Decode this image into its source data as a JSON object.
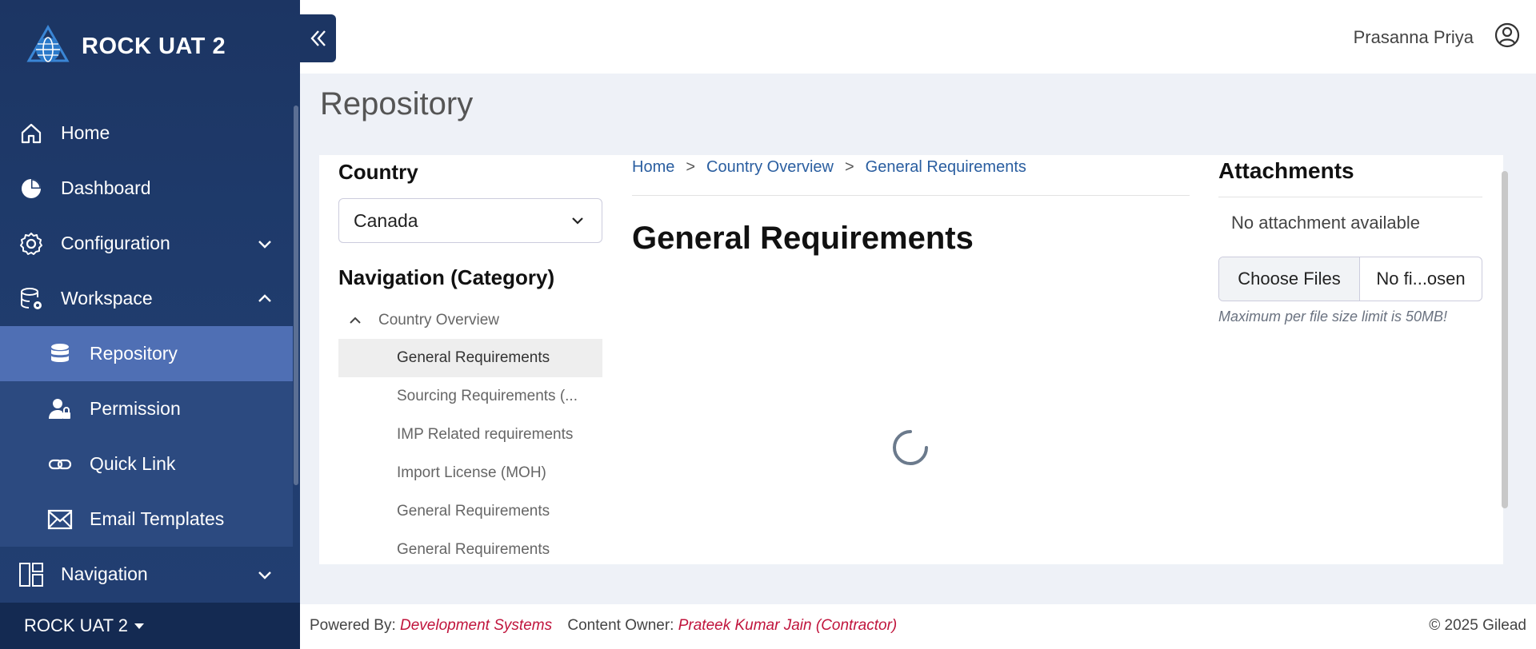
{
  "app": {
    "name": "ROCK UAT 2"
  },
  "sidebar": {
    "items": [
      {
        "label": "Home",
        "icon": "home-icon"
      },
      {
        "label": "Dashboard",
        "icon": "pie-chart-icon"
      },
      {
        "label": "Configuration",
        "icon": "gear-icon",
        "expandable": true,
        "expanded": false
      },
      {
        "label": "Workspace",
        "icon": "database-settings-icon",
        "expandable": true,
        "expanded": true
      },
      {
        "label": "Navigation",
        "icon": "layout-icon",
        "expandable": true,
        "expanded": false
      }
    ],
    "workspace_children": [
      {
        "label": "Repository",
        "icon": "database-icon",
        "active": true
      },
      {
        "label": "Permission",
        "icon": "user-lock-icon"
      },
      {
        "label": "Quick Link",
        "icon": "link-icon"
      },
      {
        "label": "Email Templates",
        "icon": "envelope-icon"
      }
    ],
    "footer": {
      "label": "ROCK UAT 2"
    }
  },
  "topbar": {
    "user_name": "Prasanna Priya"
  },
  "page": {
    "title": "Repository"
  },
  "country": {
    "label": "Country",
    "selected": "Canada"
  },
  "navigation": {
    "label": "Navigation (Category)",
    "parent": "Country Overview",
    "children": [
      {
        "label": "General Requirements",
        "active": true
      },
      {
        "label": "Sourcing Requirements (..."
      },
      {
        "label": "IMP Related requirements"
      },
      {
        "label": "Import License (MOH)"
      },
      {
        "label": "General Requirements"
      },
      {
        "label": "General Requirements"
      }
    ]
  },
  "breadcrumb": {
    "items": [
      "Home",
      "Country Overview",
      "General Requirements"
    ],
    "separator": ">"
  },
  "document": {
    "title": "General Requirements"
  },
  "attachments": {
    "label": "Attachments",
    "empty_text": "No attachment available",
    "choose_label": "Choose Files",
    "file_status": "No fi...osen",
    "note": "Maximum per file size limit is 50MB!"
  },
  "footer": {
    "powered_label": "Powered By:",
    "powered_value": "Development Systems",
    "owner_label": "Content Owner:",
    "owner_value": "Prateek Kumar Jain (Contractor)",
    "copyright": "© 2025 Gilead"
  },
  "colors": {
    "sidebar": "#1f3b6c",
    "sidebar_active": "#4f6fb4",
    "link": "#2a5ea0",
    "accent": "#c0143c"
  }
}
